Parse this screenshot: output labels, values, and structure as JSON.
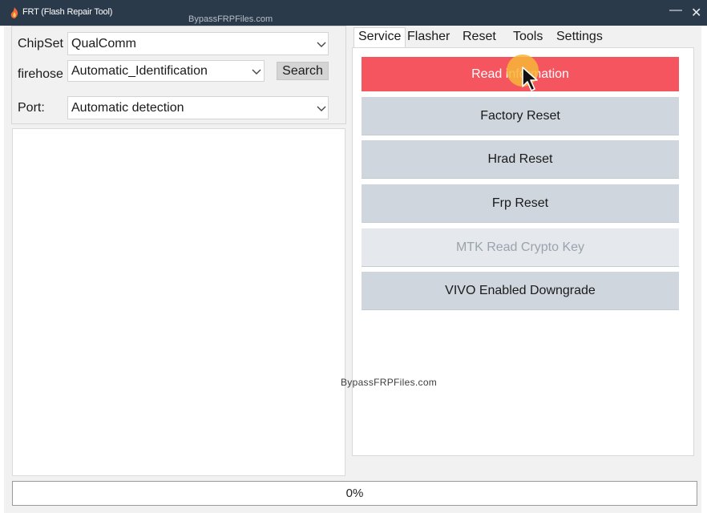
{
  "window": {
    "title": "FRT (Flash Repair Tool)",
    "watermark_top": "BypassFRPFiles.com",
    "minimize_glyph": "—",
    "close_glyph": "✕"
  },
  "left": {
    "chipset_label": "ChipSet",
    "chipset_value": "QualComm",
    "firehose_label": "firehose",
    "firehose_value": "Automatic_Identification",
    "search_label": "Search",
    "port_label": "Port:",
    "port_value": "Automatic detection"
  },
  "tabs": [
    {
      "label": "Service",
      "active": true
    },
    {
      "label": "Flasher"
    },
    {
      "label": "Reset"
    },
    {
      "label": "Tools"
    },
    {
      "label": "Settings"
    }
  ],
  "actions": [
    {
      "label": "Read information",
      "state": "highlight"
    },
    {
      "label": "Factory Reset"
    },
    {
      "label": "Hrad Reset"
    },
    {
      "label": "Frp Reset"
    },
    {
      "label": "MTK Read Crypto Key",
      "state": "disabled"
    },
    {
      "label": "VIVO Enabled Downgrade"
    }
  ],
  "watermark_mid": "BypassFRPFiles.com",
  "progress": {
    "value": 0,
    "text": "0%"
  },
  "colors": {
    "titlebar": "#2b3a4a",
    "highlight": "#f5555f",
    "button": "#cfd6de",
    "disabled": "#e5e9ed"
  },
  "icons": {
    "app": "app-flame-icon",
    "dropdown": "chevron-down-icon",
    "cursor": "mouse-pointer-icon"
  }
}
